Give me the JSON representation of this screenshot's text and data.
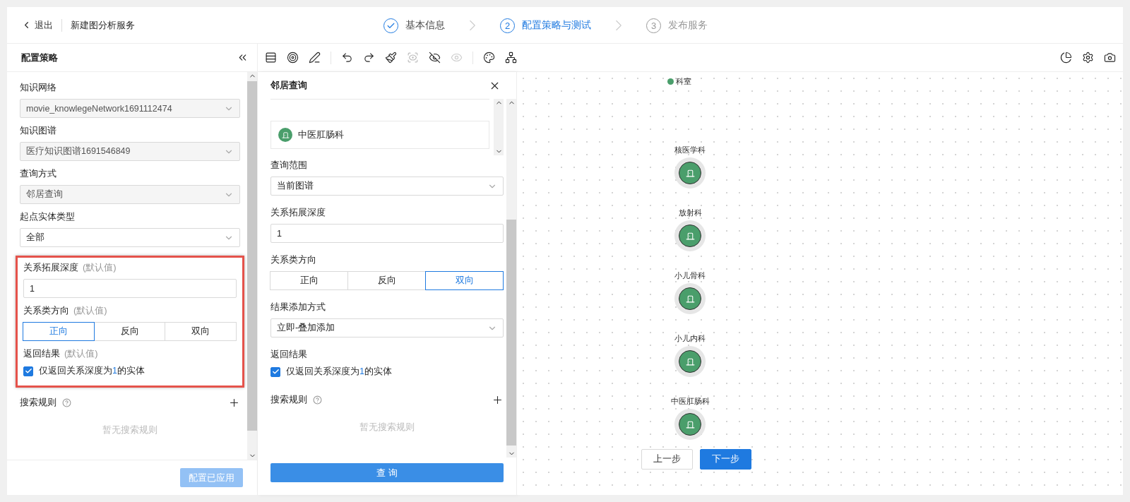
{
  "header": {
    "back": "退出",
    "title": "新建图分析服务",
    "steps": [
      {
        "label": "基本信息",
        "completed": true,
        "selected": false
      },
      {
        "number": "2",
        "label": "配置策略与测试",
        "completed": false,
        "selected": true
      },
      {
        "number": "3",
        "label": "发布服务",
        "completed": false,
        "selected": false
      }
    ]
  },
  "left_panel": {
    "title": "配置策略",
    "fields": [
      {
        "kind": "select",
        "label": "知识网络",
        "value": "movie_knowlegeNetwork1691112474",
        "disabled": true
      },
      {
        "kind": "select",
        "label": "知识图谱",
        "value": "医疗知识图谱1691546849",
        "disabled": true
      },
      {
        "kind": "select",
        "label": "查询方式",
        "value": "邻居查询",
        "disabled": true
      },
      {
        "kind": "select",
        "label": "起点实体类型",
        "value": "全部",
        "disabled": false
      }
    ],
    "highlighted_fields": [
      {
        "kind": "input",
        "label": "关系拓展深度",
        "hint": "(默认值)",
        "value": "1"
      },
      {
        "kind": "segmented",
        "label": "关系类方向",
        "hint": "(默认值)",
        "options": [
          {
            "label": "正向",
            "selected": true
          },
          {
            "label": "反向",
            "selected": false
          },
          {
            "label": "双向",
            "selected": false
          }
        ]
      },
      {
        "kind": "checkbox",
        "label": "返回结果",
        "hint": "(默认值)",
        "checked": true,
        "text_parts": [
          "仅返回关系深度为",
          "1",
          "的实体"
        ]
      }
    ],
    "search_rules": {
      "label": "搜索规则",
      "empty": "暂无搜索规则"
    },
    "apply_button": {
      "label": "配置已应用",
      "disabled": true
    }
  },
  "query_panel": {
    "title": "邻居查询",
    "entities": [
      "中医肛肠科"
    ],
    "fields": [
      {
        "kind": "select",
        "label": "查询范围",
        "value": "当前图谱",
        "disabled": false
      },
      {
        "kind": "input",
        "label": "关系拓展深度",
        "value": "1"
      },
      {
        "kind": "segmented",
        "label": "关系类方向",
        "options": [
          {
            "label": "正向",
            "selected": false
          },
          {
            "label": "反向",
            "selected": false
          },
          {
            "label": "双向",
            "selected": true
          }
        ]
      },
      {
        "kind": "select",
        "label": "结果添加方式",
        "value": "立即-叠加添加",
        "disabled": false
      },
      {
        "kind": "checkbox",
        "label": "返回结果",
        "checked": true,
        "text_parts": [
          "仅返回关系深度为",
          "1",
          "的实体"
        ]
      }
    ],
    "search_rules": {
      "label": "搜索规则",
      "empty": "暂无搜索规则"
    },
    "query_button": "查 询"
  },
  "canvas": {
    "legend": [
      {
        "label": "科室",
        "color": "#4a9e6b"
      }
    ],
    "nodes": [
      {
        "label": "核医学科",
        "color": "#4a9e6b"
      },
      {
        "label": "放射科",
        "color": "#4a9e6b"
      },
      {
        "label": "小儿骨科",
        "color": "#4a9e6b"
      },
      {
        "label": "小儿内科",
        "color": "#4a9e6b"
      },
      {
        "label": "中医肛肠科",
        "color": "#4a9e6b"
      }
    ],
    "buttons": [
      {
        "label": "上一步",
        "primary": false
      },
      {
        "label": "下一步",
        "primary": true
      }
    ]
  }
}
